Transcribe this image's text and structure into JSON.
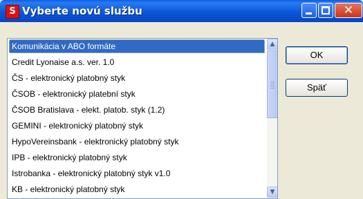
{
  "window": {
    "title": "Vyberte novú službu",
    "icon": "app-logo-icon",
    "app_icon_glyph": "S",
    "close_glyph": "✕"
  },
  "list": {
    "selected_index": 0,
    "items": [
      "Komunikácia v ABO formáte",
      "Credit Lyonaise a.s. ver. 1.0",
      "ČS - elektronický platobný styk",
      "ČSOB - elektronický platební styk",
      "ČSOB Bratislava - elekt. platob. styk (1.2)",
      "GEMINI - elektronický platobný styk",
      "HypoVereinsbank - elektronický platobný styk",
      "IPB - elektronický platobný styk",
      "Istrobanka - elektronický platobný styk v1.0",
      "KB - elektronický platobný styk"
    ]
  },
  "scrollbar": {
    "up_arrow": "▲",
    "down_arrow": "▼"
  },
  "buttons": {
    "ok": "OK",
    "back": "Späť"
  },
  "colors": {
    "selection": "#316ac5",
    "titlebar": "#0b57d8",
    "dialog_bg": "#ece9d8"
  }
}
